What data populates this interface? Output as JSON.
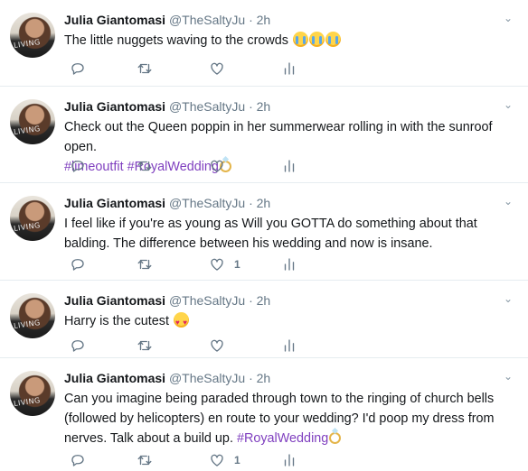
{
  "tweets": [
    {
      "name": "Julia Giantomasi",
      "handle": "@TheSaltyJu",
      "separator": "·",
      "time": "2h",
      "avatar_text": "LIVING",
      "text": "The little nuggets waving to the crowds",
      "hashtags": "",
      "emoji": [
        "face-with-tears-emoji",
        "face-with-tears-emoji",
        "face-with-tears-emoji"
      ],
      "like_count": ""
    },
    {
      "name": "Julia Giantomasi",
      "handle": "@TheSaltyJu",
      "separator": "·",
      "time": "2h",
      "avatar_text": "LIVING",
      "text": "Check out the Queen poppin in her summerwear rolling in with the sunroof open.",
      "hashtags": "#limeoutfit #RoyalWedding",
      "emoji": [
        "ring-emoji"
      ],
      "like_count": ""
    },
    {
      "name": "Julia Giantomasi",
      "handle": "@TheSaltyJu",
      "separator": "·",
      "time": "2h",
      "avatar_text": "LIVING",
      "text": "I feel like if you're as young as Will you GOTTA do something about that balding. The difference between his wedding and now is insane.",
      "hashtags": "",
      "emoji": [],
      "like_count": "1"
    },
    {
      "name": "Julia Giantomasi",
      "handle": "@TheSaltyJu",
      "separator": "·",
      "time": "2h",
      "avatar_text": "LIVING",
      "text": "Harry is the cutest",
      "hashtags": "",
      "emoji": [
        "heart-eyes-emoji"
      ],
      "like_count": ""
    },
    {
      "name": "Julia Giantomasi",
      "handle": "@TheSaltyJu",
      "separator": "·",
      "time": "2h",
      "avatar_text": "LIVING",
      "text": "Can you imagine being paraded through town to the ringing of church bells (followed by helicopters) en route to your wedding? I'd poop my dress from nerves. Talk about a build up.",
      "hashtags": "#RoyalWedding",
      "emoji": [
        "ring-emoji"
      ],
      "like_count": "1"
    }
  ],
  "icons": {
    "reply": "reply-icon",
    "retweet": "retweet-icon",
    "like": "heart-icon",
    "analytics": "analytics-icon",
    "menu": "chevron-down-icon"
  },
  "colors": {
    "hashtag": "#7f3fbf",
    "secondary_text": "#657786",
    "divider": "#e6ecf0"
  }
}
